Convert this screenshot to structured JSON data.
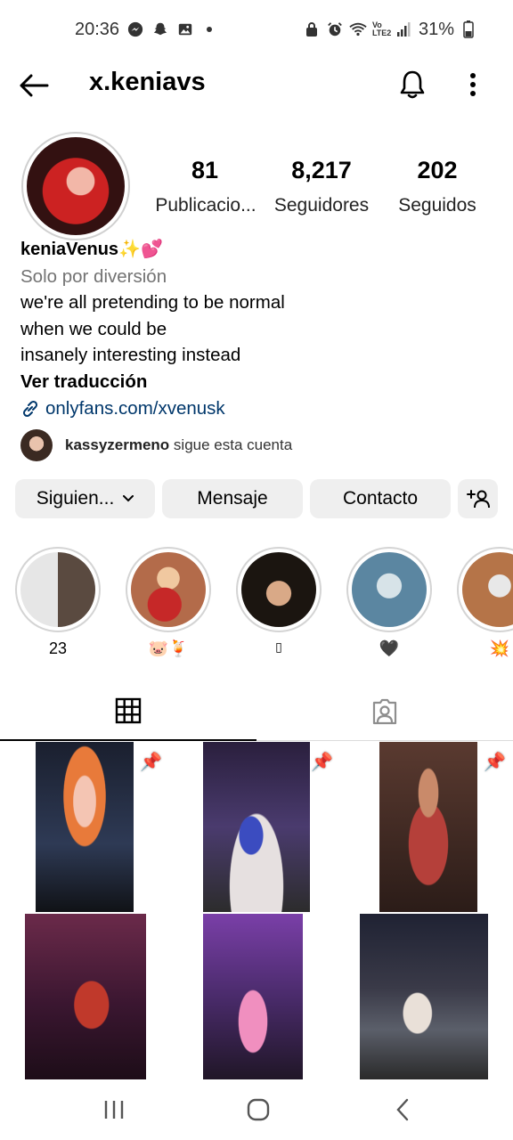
{
  "status_bar": {
    "time": "20:36",
    "battery": "31%",
    "network": "Vo LTE2"
  },
  "header": {
    "username": "x.keniavs"
  },
  "profile": {
    "stats": [
      {
        "value": "81",
        "label": "Publicacio..."
      },
      {
        "value": "8,217",
        "label": "Seguidores"
      },
      {
        "value": "202",
        "label": "Seguidos"
      }
    ],
    "display_name": "keniaVenus✨💕",
    "category": "Solo por diversión",
    "bio_lines": [
      "we're all pretending to be normal",
      "when we could be",
      "insanely interesting instead"
    ],
    "translate_label": "Ver traducción",
    "link": "onlyfans.com/xvenusk",
    "followed_by_user": "kassyzermeno",
    "followed_by_text": "sigue esta cuenta"
  },
  "actions": {
    "following": "Siguien...",
    "message": "Mensaje",
    "contact": "Contacto"
  },
  "highlights": [
    {
      "label": "23"
    },
    {
      "label": "🐷🍹"
    },
    {
      "label": "▯"
    },
    {
      "label": "🖤"
    },
    {
      "label": "💥"
    }
  ],
  "colors": {
    "link": "#00376b",
    "button_bg": "#efefef",
    "secondary_text": "#737373"
  }
}
